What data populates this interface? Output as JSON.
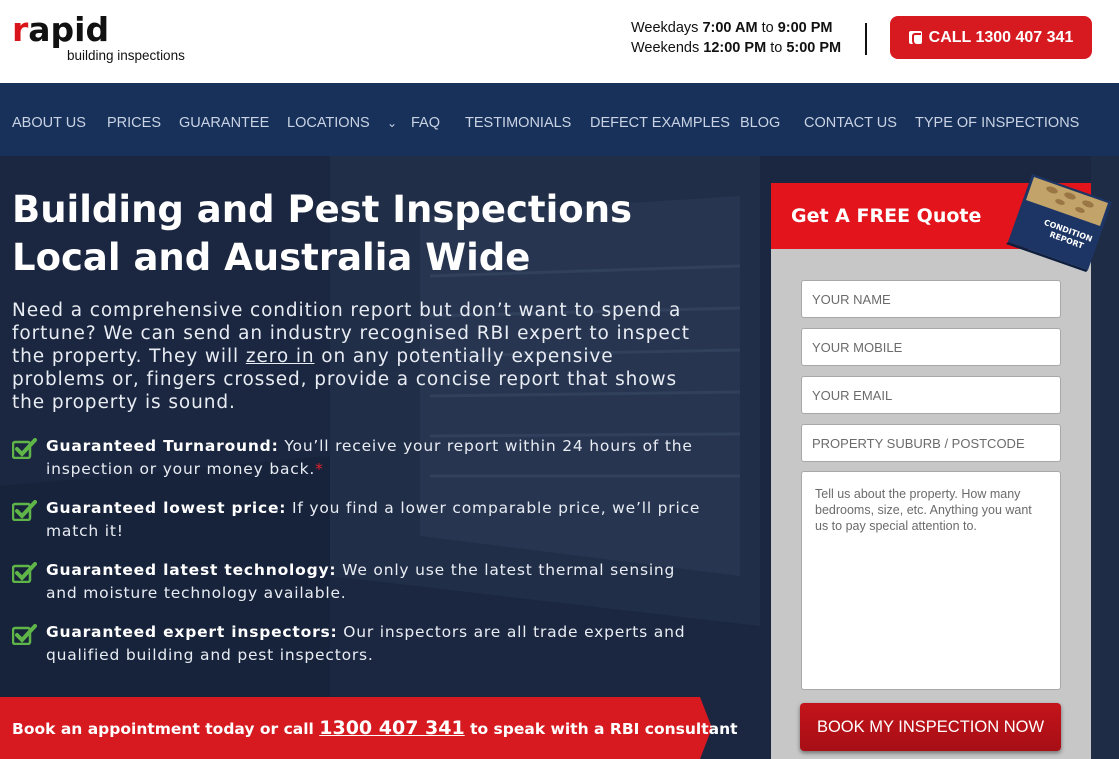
{
  "header": {
    "logo": {
      "word_r": "r",
      "word_rest": "apid",
      "subtitle": "building inspections"
    },
    "hours": {
      "weekdays_label": "Weekdays",
      "weekdays_open": "7:00 AM",
      "weekdays_to": "to",
      "weekdays_close": "9:00 PM",
      "weekends_label": "Weekends",
      "weekends_open": "12:00 PM",
      "weekends_to": "to",
      "weekends_close": "5:00 PM"
    },
    "call_button": "CALL 1300 407 341"
  },
  "nav": {
    "items": [
      "ABOUT US",
      "PRICES",
      "GUARANTEE",
      "LOCATIONS",
      "FAQ",
      "TESTIMONIALS",
      "DEFECT EXAMPLES",
      "BLOG",
      "CONTACT US",
      "TYPE OF INSPECTIONS"
    ],
    "locations_caret": "⌄"
  },
  "hero": {
    "title_line1": "Building and Pest Inspections",
    "title_line2": "Local and Australia Wide",
    "intro_before": "Need a comprehensive condition report but don’t want to spend a fortune? We can send an industry recognised RBI expert to inspect the property. They will ",
    "intro_link": "zero in",
    "intro_after": " on any potentially expensive problems or, fingers crossed, provide a concise report that shows the property is sound.",
    "guarantees": [
      {
        "title": "Guaranteed Turnaround:",
        "text": " You’ll receive your report within 24 hours of the inspection or your money back.",
        "asterisk": "*"
      },
      {
        "title": "Guaranteed lowest price:",
        "text": " If you find a lower comparable price, we’ll price match it!",
        "asterisk": ""
      },
      {
        "title": "Guaranteed latest technology:",
        "text": " We only use the latest thermal sensing and moisture technology available.",
        "asterisk": ""
      },
      {
        "title": "Guaranteed expert inspectors:",
        "text": " Our inspectors are all trade experts and qualified building and pest inspectors.",
        "asterisk": ""
      }
    ],
    "banner_before": "Book an appointment today or call ",
    "banner_phone": "1300 407 341",
    "banner_after": " to speak with a RBI consultant"
  },
  "quote": {
    "title": "Get A FREE Quote",
    "book_label_1": "CONDITION",
    "book_label_2": "REPORT",
    "fields": {
      "name": "YOUR NAME",
      "mobile": "YOUR MOBILE",
      "email": "YOUR EMAIL",
      "suburb": "PROPERTY SUBURB / POSTCODE"
    },
    "textarea_placeholder": "Tell us about the property. How many bedrooms, size, etc. Anything you want us to pay special attention to.",
    "submit": "BOOK MY INSPECTION NOW"
  },
  "colors": {
    "brand_red": "#d71920",
    "nav_blue": "#18315a",
    "check_green": "#5fb548"
  }
}
